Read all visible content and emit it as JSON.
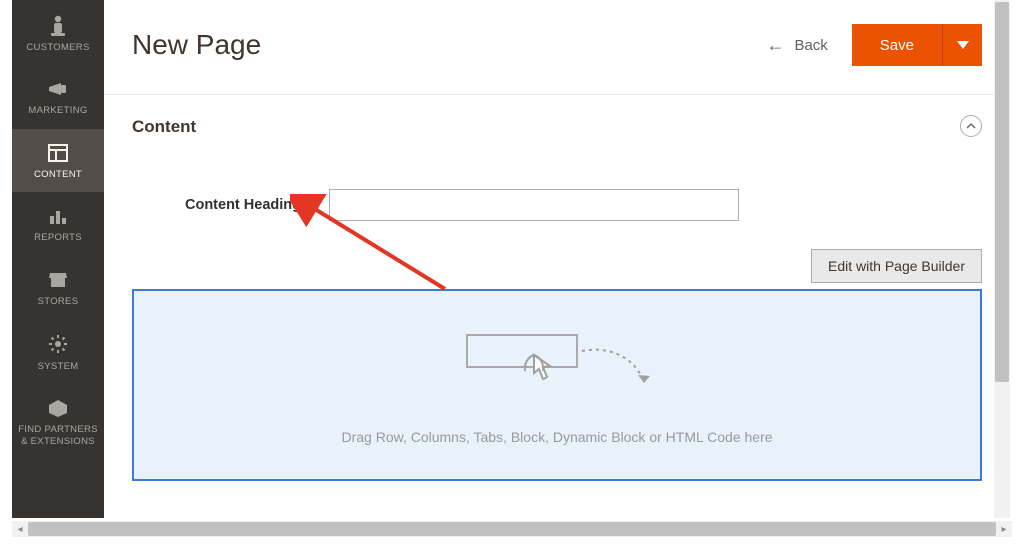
{
  "sidebar": {
    "items": [
      {
        "label": "CUSTOMERS",
        "icon": "customers-icon"
      },
      {
        "label": "MARKETING",
        "icon": "marketing-icon"
      },
      {
        "label": "CONTENT",
        "icon": "content-icon",
        "active": true
      },
      {
        "label": "REPORTS",
        "icon": "reports-icon"
      },
      {
        "label": "STORES",
        "icon": "stores-icon"
      },
      {
        "label": "SYSTEM",
        "icon": "system-icon"
      },
      {
        "label": "FIND PARTNERS & EXTENSIONS",
        "icon": "partners-icon"
      }
    ]
  },
  "header": {
    "title": "New Page",
    "back_label": "Back",
    "save_label": "Save"
  },
  "content_section": {
    "title": "Content",
    "heading_label": "Content Heading",
    "heading_value": "",
    "edit_button_label": "Edit with Page Builder",
    "drag_hint": "Drag Row, Columns, Tabs, Block, Dynamic Block or HTML Code here"
  },
  "colors": {
    "primary_accent": "#eb5202",
    "builder_border": "#3a7bd5",
    "builder_bg": "#e9f2fb"
  }
}
